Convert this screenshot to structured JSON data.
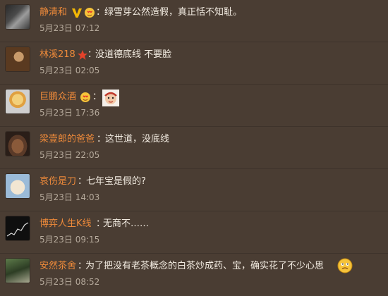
{
  "comments": [
    {
      "user": "静清和",
      "colon": "：",
      "text": "绿雪芽公然造假，真正恬不知耻。",
      "time": "5月23日 07:12"
    },
    {
      "user": "林溪218",
      "colon": "：",
      "text": "没道德底线 不要脸",
      "time": "5月23日 02:05"
    },
    {
      "user": "巨鹏众酒",
      "colon": "：",
      "text": "",
      "time": "5月23日 17:36"
    },
    {
      "user": "梁壹郎的爸爸",
      "colon": "：",
      "text": "这世道，没底线",
      "time": "5月23日 22:05"
    },
    {
      "user": "哀伤是刀",
      "colon": "：",
      "text": "七年宝是假的?",
      "time": "5月23日 14:03"
    },
    {
      "user": "博弈人生K线",
      "colon": "：",
      "text": "无商不……",
      "time": "5月23日 09:15"
    },
    {
      "user": "安然茶舍",
      "colon": "：",
      "text": "为了把没有老茶概念的白茶炒成药、宝，确实花了不少心思",
      "time": "5月23日 08:52"
    }
  ],
  "colors": {
    "background": "#4a3d33",
    "username": "#ee8a3a",
    "text": "#f3ece2",
    "time": "#b6aa9c",
    "vip_badge": "#f2b705"
  },
  "icons": [
    "vip-v-icon",
    "heart-face-icon",
    "star-badge-icon",
    "sticker-emoji-icon",
    "worried-face-emoji-icon"
  ]
}
